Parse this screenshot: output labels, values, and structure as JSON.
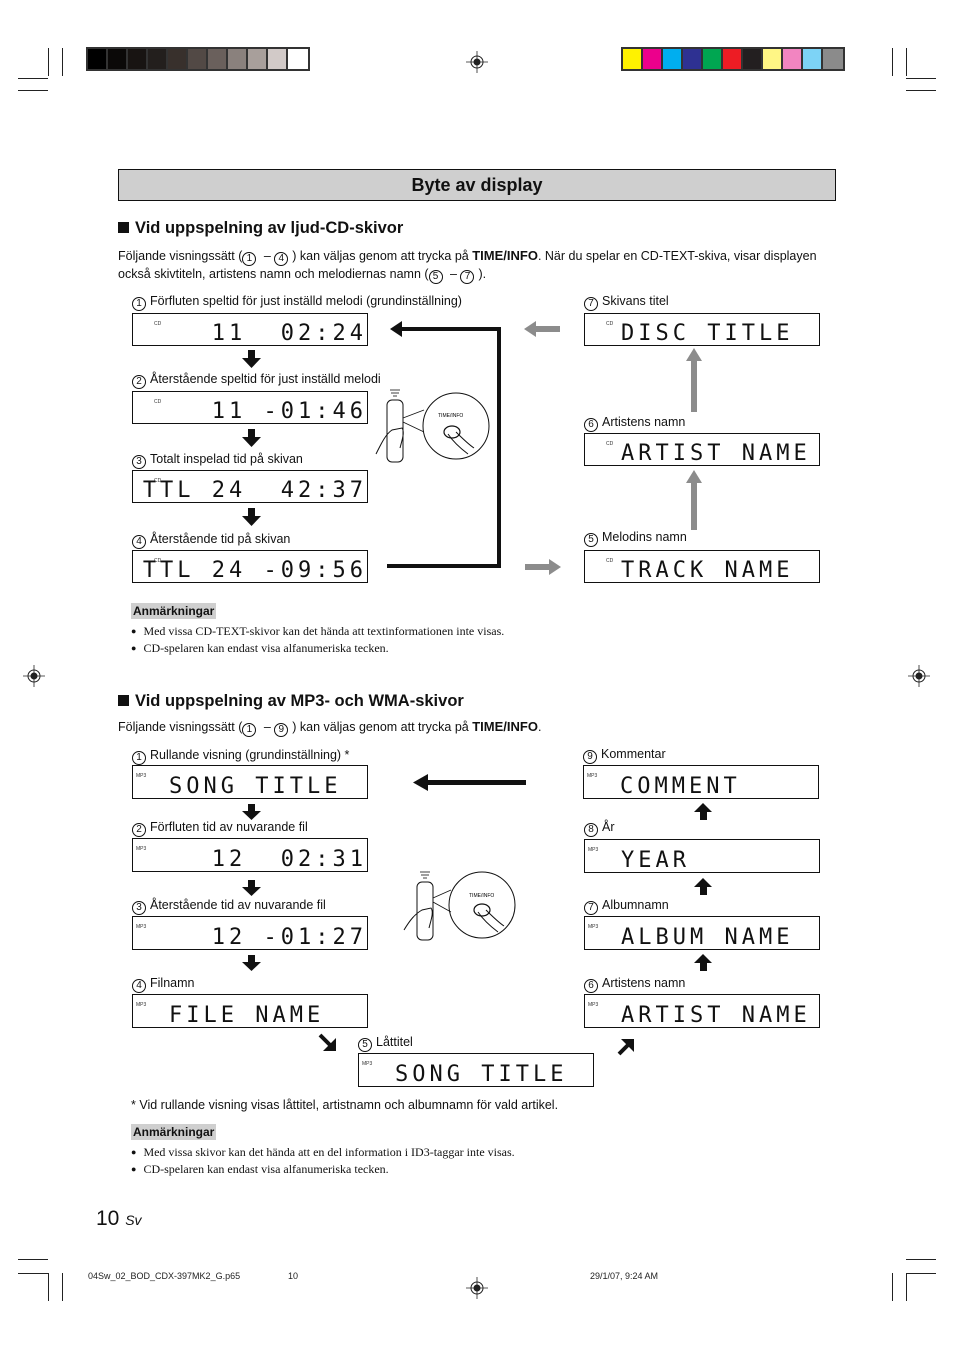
{
  "page": {
    "title": "Byte av display",
    "page_number": "10",
    "language_code": "Sv"
  },
  "color_bars": {
    "grayscale": [
      "#000000",
      "#0b0908",
      "#181412",
      "#231f1d",
      "#38302c",
      "#524945",
      "#6a605c",
      "#8a817d",
      "#a89f9b",
      "#d2cac8",
      "#ffffff"
    ],
    "process": [
      "#fff200",
      "#ec008c",
      "#00aeef",
      "#2e3192",
      "#00a651",
      "#ed1c24",
      "#231f20",
      "#fff685",
      "#f285c1",
      "#7dd3f6",
      "#8b8b8b"
    ]
  },
  "cd_section": {
    "heading": "Vid uppspelning av ljud-CD-skivor",
    "intro_pre": "Följande visningssätt (",
    "intro_range_start": "1",
    "intro_dash": " – ",
    "intro_range_end": "4",
    "intro_mid": ") kan väljas genom att trycka på ",
    "intro_button": "TIME/INFO",
    "intro_post": ". När du spelar en CD-TEXT-skiva, visar displayen",
    "intro_line2_pre": "också skivtiteln, artistens namn och melodiernas namn (",
    "intro_line2_start": "5",
    "intro_line2_end": "7",
    "intro_line2_post": ").",
    "displays": [
      {
        "num": "1",
        "label": "Förfluten speltid för just inställd melodi (grundinställning)",
        "tag": "CD",
        "text": "11  02:24"
      },
      {
        "num": "2",
        "label": "Återstående speltid för just inställd melodi",
        "tag": "CD",
        "text": "11 -01:46"
      },
      {
        "num": "3",
        "label": "Totalt inspelad tid på skivan",
        "tag": "CD",
        "text": "TTL 24  42:37"
      },
      {
        "num": "4",
        "label": "Återstående tid på skivan",
        "tag": "CD",
        "text": "TTL 24 -09:56"
      },
      {
        "num": "7",
        "label": "Skivans titel",
        "tag": "CD",
        "text": "DISC TITLE"
      },
      {
        "num": "6",
        "label": "Artistens namn",
        "tag": "CD",
        "text": "ARTIST NAME"
      },
      {
        "num": "5",
        "label": "Melodins namn",
        "tag": "CD",
        "text": "TRACK NAME"
      }
    ],
    "remote_button_label": "TIME/INFO",
    "notes_heading": "Anmärkningar",
    "notes": [
      "Med vissa CD-TEXT-skivor kan det hända att textinformationen inte visas.",
      "CD-spelaren kan endast visa alfanumeriska tecken."
    ]
  },
  "mp3_section": {
    "heading": "Vid uppspelning av MP3- och WMA-skivor",
    "intro_pre": "Följande visningssätt (",
    "intro_range_start": "1",
    "intro_dash": " – ",
    "intro_range_end": "9",
    "intro_mid": ") kan väljas genom att trycka på ",
    "intro_button": "TIME/INFO",
    "intro_post": ".",
    "displays": [
      {
        "num": "1",
        "label": "Rullande visning (grundinställning) *",
        "tag": "MP3",
        "text": "SONG TITLE"
      },
      {
        "num": "2",
        "label": "Förfluten tid av nuvarande fil",
        "tag": "MP3",
        "text": "12  02:31"
      },
      {
        "num": "3",
        "label": "Återstående tid av nuvarande fil",
        "tag": "MP3",
        "text": "12 -01:27"
      },
      {
        "num": "4",
        "label": "Filnamn",
        "tag": "MP3",
        "text": "FILE NAME"
      },
      {
        "num": "5",
        "label": "Låttitel",
        "tag": "MP3",
        "text": "SONG TITLE"
      },
      {
        "num": "9",
        "label": "Kommentar",
        "tag": "MP3",
        "text": "COMMENT"
      },
      {
        "num": "8",
        "label": "År",
        "tag": "MP3",
        "text": "YEAR"
      },
      {
        "num": "7",
        "label": "Albumnamn",
        "tag": "MP3",
        "text": "ALBUM NAME"
      },
      {
        "num": "6",
        "label": "Artistens namn",
        "tag": "MP3",
        "text": "ARTIST NAME"
      }
    ],
    "remote_button_label": "TIME/INFO",
    "footnote": "*  Vid rullande visning visas låttitel, artistnamn och albumnamn för vald artikel.",
    "notes_heading": "Anmärkningar",
    "notes": [
      "Med vissa skivor kan det hända att en del information i ID3-taggar inte visas.",
      "CD-spelaren kan endast visa alfanumeriska tecken."
    ]
  },
  "footer": {
    "filename": "04Sw_02_BOD_CDX-397MK2_G.p65",
    "page": "10",
    "timestamp": "29/1/07, 9:24 AM"
  }
}
